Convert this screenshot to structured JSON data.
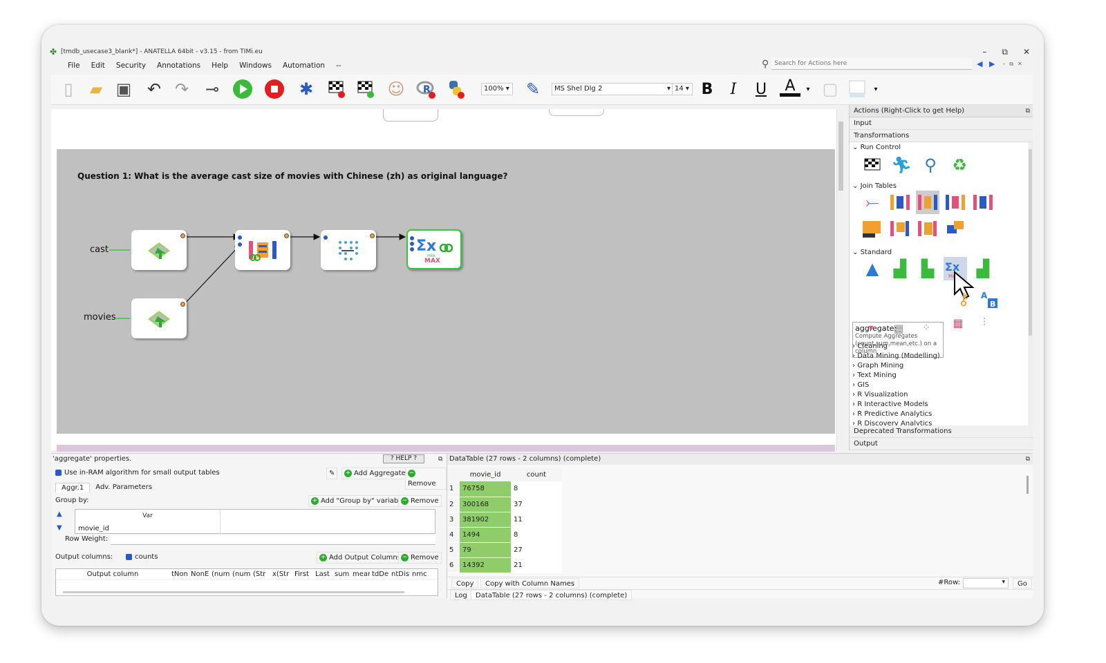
{
  "window": {
    "title": "[tmdb_usecase3_blank*] - ANATELLA 64bit - v3.15 - from TIMi.eu",
    "controls": {
      "minimize": "–",
      "restore": "⧉",
      "close": "✕"
    }
  },
  "menu": [
    "File",
    "Edit",
    "Security",
    "Annotations",
    "Help",
    "Windows",
    "Automation",
    "--"
  ],
  "search": {
    "placeholder": "Search for Actions here"
  },
  "toolbar": {
    "zoom": "100%",
    "font": "MS Shel Dlg 2",
    "font_size": "14",
    "bold": "B",
    "italic": "I",
    "underline": "U",
    "color_letter": "A"
  },
  "canvas": {
    "question": "Question 1: What is the average cast size of movies with Chinese (zh) as original language?",
    "inputs": [
      {
        "label": "cast"
      },
      {
        "label": "movies"
      }
    ]
  },
  "actions_panel": {
    "header": "Actions (Right-Click to get Help)",
    "input": "Input",
    "transformations": "Transformations",
    "cat_run_control": "Run Control",
    "cat_join_tables": "Join Tables",
    "cat_standard": "Standard",
    "tooltip_title": "aggregate:",
    "tooltip_desc": "Compute Aggregates (count,sum,mean,etc.) on a column",
    "categories": [
      "Cleaning",
      "Data Mining (Modelling)",
      "Graph Mining",
      "Text Mining",
      "GIS",
      "R Visualization",
      "R Interactive Models",
      "R Predictive Analytics",
      "R Discovery Analytics"
    ],
    "deprecated": "Deprecated Transformations",
    "output": "Output"
  },
  "properties": {
    "title": "'aggregate' properties.",
    "help": "? HELP ?",
    "use_in_ram": "Use in-RAM algorithm for small output tables",
    "add_aggregate": "Add Aggregate",
    "remove": "Remove",
    "tabs": [
      "Aggr.1",
      "Adv. Parameters"
    ],
    "group_by": "Group by:",
    "add_group_by": "Add \"Group by\" variable",
    "var_header": "Var",
    "group_var": "movie_id",
    "row_weight": "Row Weight:",
    "output_columns": "Output columns:",
    "counts_label": "counts",
    "add_output_columns": "Add Output Columns",
    "oc_headers": [
      "Output column",
      "tNon",
      "NonE",
      "(num",
      "(num",
      "(Str",
      "x(Str",
      "First",
      "Last",
      "sum",
      "mear",
      "tdDe",
      "ntDist",
      "nmc"
    ]
  },
  "datatable": {
    "title": "DataTable (27 rows - 2 columns) (complete)",
    "columns": [
      "movie_id",
      "count"
    ],
    "rows": [
      [
        "1",
        "76758",
        "8"
      ],
      [
        "2",
        "300168",
        "37"
      ],
      [
        "3",
        "381902",
        "11"
      ],
      [
        "4",
        "1494",
        "8"
      ],
      [
        "5",
        "79",
        "27"
      ],
      [
        "6",
        "14392",
        "21"
      ]
    ],
    "copy": "Copy",
    "copy_with_names": "Copy with Column Names",
    "row_label": "#Row:",
    "go": "Go",
    "log_tab": "Log",
    "log_status": "DataTable (27 rows - 2 columns) (complete)"
  },
  "colors": {
    "accent_green": "#37c837",
    "table_highlight": "#8fcc6a",
    "canvas_gray": "#c0c0c0",
    "pink_strip": "#dcc6dc"
  }
}
